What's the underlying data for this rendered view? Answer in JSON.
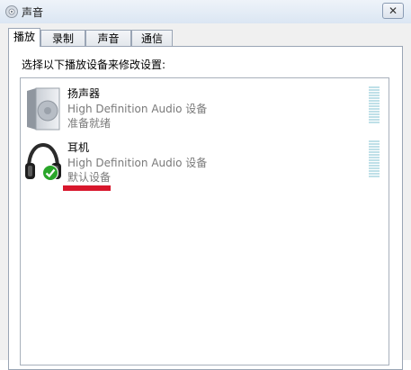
{
  "window": {
    "title": "声音",
    "close_label": "✕",
    "icon": "speaker-icon"
  },
  "tabs": [
    {
      "label": "播放",
      "active": true
    },
    {
      "label": "录制",
      "active": false
    },
    {
      "label": "声音",
      "active": false
    },
    {
      "label": "通信",
      "active": false
    }
  ],
  "instruction": "选择以下播放设备来修改设置:",
  "devices": [
    {
      "name": "扬声器",
      "description": "High Definition Audio 设备",
      "status": "准备就绪",
      "icon": "speaker-device-icon",
      "default": false
    },
    {
      "name": "耳机",
      "description": "High Definition Audio 设备",
      "status": "默认设备",
      "icon": "headphones-icon",
      "default": true
    }
  ],
  "colors": {
    "meter": "#bfe0e8",
    "default_check": "#2aa62a",
    "annotation": "#d8172c",
    "secondary_text": "#7a7a7a"
  }
}
